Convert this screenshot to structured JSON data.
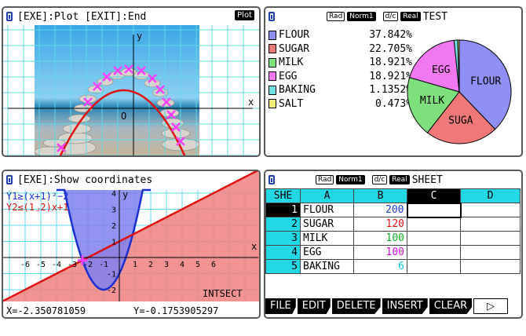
{
  "panel_plot": {
    "title": "[EXE]:Plot [EXIT]:End",
    "badge": "Plot",
    "x_axis_label": "x",
    "y_axis_label": "y",
    "origin_label": "O"
  },
  "panel_pie": {
    "tags": {
      "angle": "Rad",
      "display": "Norm1",
      "frac": "d/c",
      "mode": "Real"
    },
    "title": "TEST",
    "items": [
      {
        "name": "FLOUR",
        "percent": "37.842%",
        "value": 37.842,
        "color": "#8f8ff5",
        "pie_label": "FLOUR"
      },
      {
        "name": "SUGAR",
        "percent": "22.705%",
        "value": 22.705,
        "color": "#f07878",
        "pie_label": "SUGA"
      },
      {
        "name": "MILK",
        "percent": "18.921%",
        "value": 18.921,
        "color": "#7de07d",
        "pie_label": "MILK"
      },
      {
        "name": "EGG",
        "percent": "18.921%",
        "value": 18.921,
        "color": "#f078f0",
        "pie_label": "EGG"
      },
      {
        "name": "BAKING",
        "percent": "1.1352%",
        "value": 1.1352,
        "color": "#70e0e0",
        "pie_label": ""
      },
      {
        "name": "SALT",
        "percent": "0.473%",
        "value": 0.473,
        "color": "#f0f078",
        "pie_label": ""
      }
    ]
  },
  "panel_ineq": {
    "title": "[EXE]:Show coordinates",
    "y1": "Y1≥(x+1)²−2",
    "y2": "Y2≤(1⌟2)x+1",
    "mode_label": "INTSECT",
    "x_readout": "X=-2.350781059",
    "y_readout": "Y=-0.1753905297",
    "x_ticks": [
      "-6",
      "-5",
      "-4",
      "-3",
      "-2",
      "-1",
      "1",
      "2",
      "3",
      "4",
      "5",
      "6"
    ],
    "y_ticks": [
      "4",
      "3",
      "2",
      "1",
      "-1",
      "-2",
      "-3"
    ],
    "y_axis_label": "y",
    "x_axis_label": "x"
  },
  "panel_sheet": {
    "tags": {
      "angle": "Rad",
      "display": "Norm1",
      "frac": "d/c",
      "mode": "Real"
    },
    "title": "SHEET",
    "corner": "SHE",
    "columns": [
      "A",
      "B",
      "C",
      "D"
    ],
    "rows": [
      {
        "n": "1",
        "a": "FLOUR",
        "b": "200",
        "b_color": "#1a3fd8"
      },
      {
        "n": "2",
        "a": "SUGAR",
        "b": "120",
        "b_color": "#e01010"
      },
      {
        "n": "3",
        "a": "MILK",
        "b": "100",
        "b_color": "#10b020"
      },
      {
        "n": "4",
        "a": "EGG",
        "b": "100",
        "b_color": "#e010e0"
      },
      {
        "n": "5",
        "a": "BAKING",
        "b": "6",
        "b_color": "#10d0e0"
      }
    ]
  },
  "fn_keys": [
    "FILE",
    "EDIT",
    "DELETE",
    "INSERT",
    "CLEAR",
    "▷"
  ]
}
